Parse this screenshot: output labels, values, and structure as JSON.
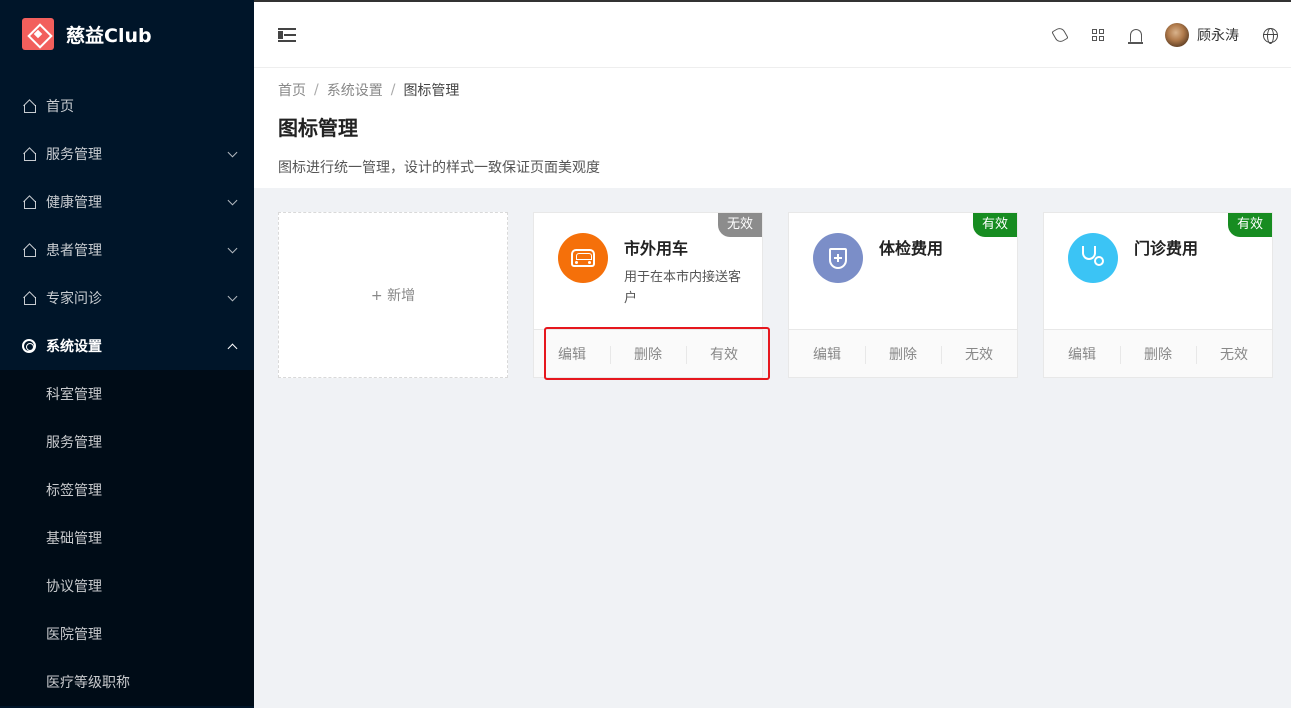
{
  "app": {
    "logo_text": "慈益Club"
  },
  "sidebar": {
    "items": [
      {
        "label": "首页",
        "icon": "home-icon"
      },
      {
        "label": "服务管理",
        "icon": "home-icon"
      },
      {
        "label": "健康管理",
        "icon": "home-icon"
      },
      {
        "label": "患者管理",
        "icon": "home-icon"
      },
      {
        "label": "专家问诊",
        "icon": "home-icon"
      },
      {
        "label": "系统设置",
        "icon": "gear-icon",
        "expanded": true
      }
    ],
    "subitems": [
      {
        "label": "科室管理"
      },
      {
        "label": "服务管理"
      },
      {
        "label": "标签管理"
      },
      {
        "label": "基础管理"
      },
      {
        "label": "协议管理"
      },
      {
        "label": "医院管理"
      },
      {
        "label": "医疗等级职称"
      }
    ]
  },
  "header": {
    "user_name": "顾永涛"
  },
  "breadcrumb": [
    "首页",
    "系统设置",
    "图标管理"
  ],
  "page": {
    "title": "图标管理",
    "description": "图标进行统一管理，设计的样式一致保证页面美观度"
  },
  "add_card": {
    "label": "+ 新增"
  },
  "cards": [
    {
      "title": "市外用车",
      "description": "用于在本市内接送客户",
      "status": "无效",
      "icon": "car-icon",
      "color": "#f5700a",
      "actions": [
        "编辑",
        "删除",
        "有效"
      ]
    },
    {
      "title": "体检费用",
      "description": "",
      "status": "有效",
      "icon": "shield-icon",
      "color": "#7b8ec8",
      "actions": [
        "编辑",
        "删除",
        "无效"
      ]
    },
    {
      "title": "门诊费用",
      "description": "",
      "status": "有效",
      "icon": "stethoscope-icon",
      "color": "#3bc4f5",
      "actions": [
        "编辑",
        "删除",
        "无效"
      ]
    }
  ],
  "colors": {
    "sidebar_bg": "#001529",
    "valid": "#178c21",
    "invalid": "#8c8c8c",
    "highlight": "#e6171e"
  }
}
